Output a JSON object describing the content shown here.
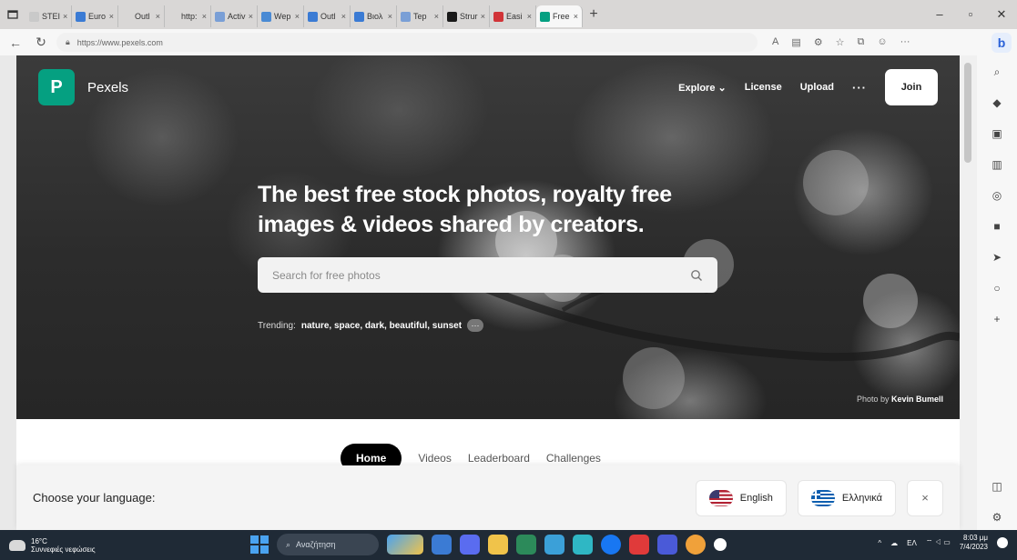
{
  "browser": {
    "tabs": [
      {
        "label": "STEI",
        "color": "#c9c9c9"
      },
      {
        "label": "Euro",
        "color": "#3b7bd4"
      },
      {
        "label": "Outl",
        "color": "#d9d7d6"
      },
      {
        "label": "http:",
        "color": "#d9d7d6"
      },
      {
        "label": "Activ",
        "color": "#7a9fd6"
      },
      {
        "label": "Wep",
        "color": "#4a8ad4"
      },
      {
        "label": "Outl",
        "color": "#3b7bd4"
      },
      {
        "label": "Βιολ",
        "color": "#3b7bd4"
      },
      {
        "label": "Tep",
        "color": "#7a9fd6"
      },
      {
        "label": "Strur",
        "color": "#1a1a1a"
      },
      {
        "label": "Easi",
        "color": "#d13438"
      },
      {
        "label": "Free",
        "color": "#05a081"
      }
    ],
    "url": "https://www.pexels.com"
  },
  "site": {
    "brand": "Pexels",
    "logo_letter": "P",
    "nav": {
      "explore": "Explore",
      "license": "License",
      "upload": "Upload",
      "more": "···",
      "join": "Join"
    },
    "headline": "The best free stock photos, royalty free images & videos shared by creators.",
    "search_placeholder": "Search for free photos",
    "trending_label": "Trending:",
    "trending_tags": "nature, space, dark, beautiful, sunset",
    "credit_prefix": "Photo by",
    "credit_name": "Kevin Bumell",
    "subnav": {
      "home": "Home",
      "videos": "Videos",
      "leaderboard": "Leaderboard",
      "challenges": "Challenges"
    }
  },
  "language_bar": {
    "label": "Choose your language:",
    "english": "English",
    "greek": "Ελληνικά",
    "close": "×"
  },
  "taskbar": {
    "weather_temp": "16°C",
    "weather_desc": "Συννεφιές νεφώσεις",
    "search_label": "Αναζήτηση",
    "lang": "ΕΛ",
    "time": "8:03 μμ",
    "date": "7/4/2023"
  },
  "colors": {
    "brand_green": "#05a081"
  }
}
